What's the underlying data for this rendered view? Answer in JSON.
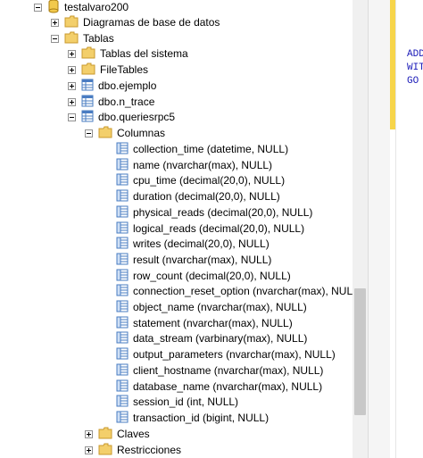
{
  "tree": {
    "database": "testalvaro200",
    "diagramas": "Diagramas de base de datos",
    "tablas": "Tablas",
    "tablas_sistema": "Tablas del sistema",
    "filetables": "FileTables",
    "tables": [
      "dbo.ejemplo",
      "dbo.n_trace",
      "dbo.queriesrpc5"
    ],
    "columnas": "Columnas",
    "columns": [
      "collection_time (datetime, NULL)",
      "name (nvarchar(max), NULL)",
      "cpu_time (decimal(20,0), NULL)",
      "duration (decimal(20,0), NULL)",
      "physical_reads (decimal(20,0), NULL)",
      "logical_reads (decimal(20,0), NULL)",
      "writes (decimal(20,0), NULL)",
      "result (nvarchar(max), NULL)",
      "row_count (decimal(20,0), NULL)",
      "connection_reset_option (nvarchar(max), NULL)",
      "object_name (nvarchar(max), NULL)",
      "statement (nvarchar(max), NULL)",
      "data_stream (varbinary(max), NULL)",
      "output_parameters (nvarchar(max), NULL)",
      "client_hostname (nvarchar(max), NULL)",
      "database_name (nvarchar(max), NULL)",
      "session_id (int, NULL)",
      "transaction_id (bigint, NULL)"
    ],
    "claves": "Claves",
    "restricciones": "Restricciones"
  },
  "editor": {
    "lines": [
      "ADD",
      "WIT",
      "GO"
    ]
  },
  "colors": {
    "folder": "#e8b84a",
    "table_icon": "#4a7cc2",
    "keyword": "#1a1ab8",
    "margin": "#f7d54a"
  }
}
